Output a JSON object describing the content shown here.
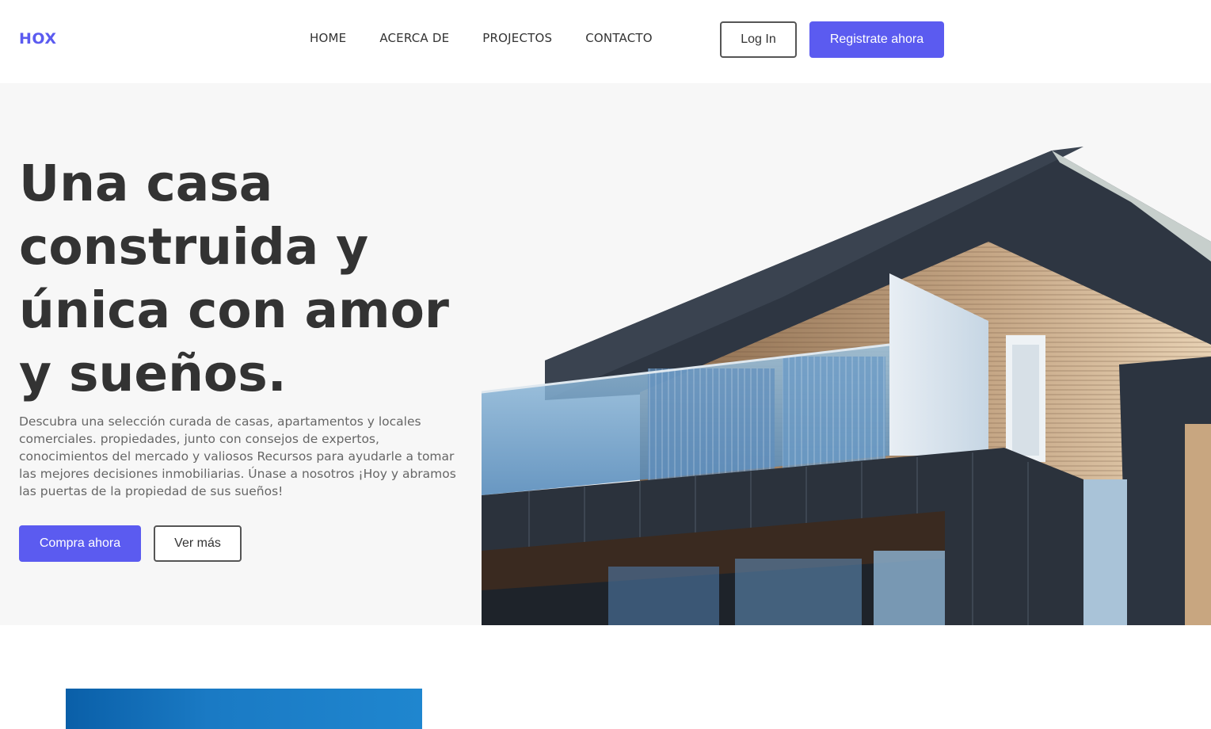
{
  "brand": {
    "logo": "HOX",
    "accent_color": "#5b5bf0"
  },
  "nav": {
    "links": [
      "HOME",
      "ACERCA DE",
      "PROJECTOS",
      "CONTACTO"
    ],
    "login_label": "Log In",
    "register_label": "Registrate ahora"
  },
  "hero": {
    "title": "Una casa construida y única con amor y sueños.",
    "description": "Descubra una selección curada de casas, apartamentos y locales comerciales. propiedades, junto con consejos de expertos, conocimientos del mercado y valiosos Recursos para ayudarle a tomar las mejores decisiones inmobiliarias. Únase a nosotros ¡Hoy y abramos las puertas de la propiedad de sus sueños!",
    "primary_button": "Compra ahora",
    "secondary_button": "Ver más",
    "image": "modern-house-photo"
  },
  "section2": {
    "image": "blue-sky-photo"
  }
}
